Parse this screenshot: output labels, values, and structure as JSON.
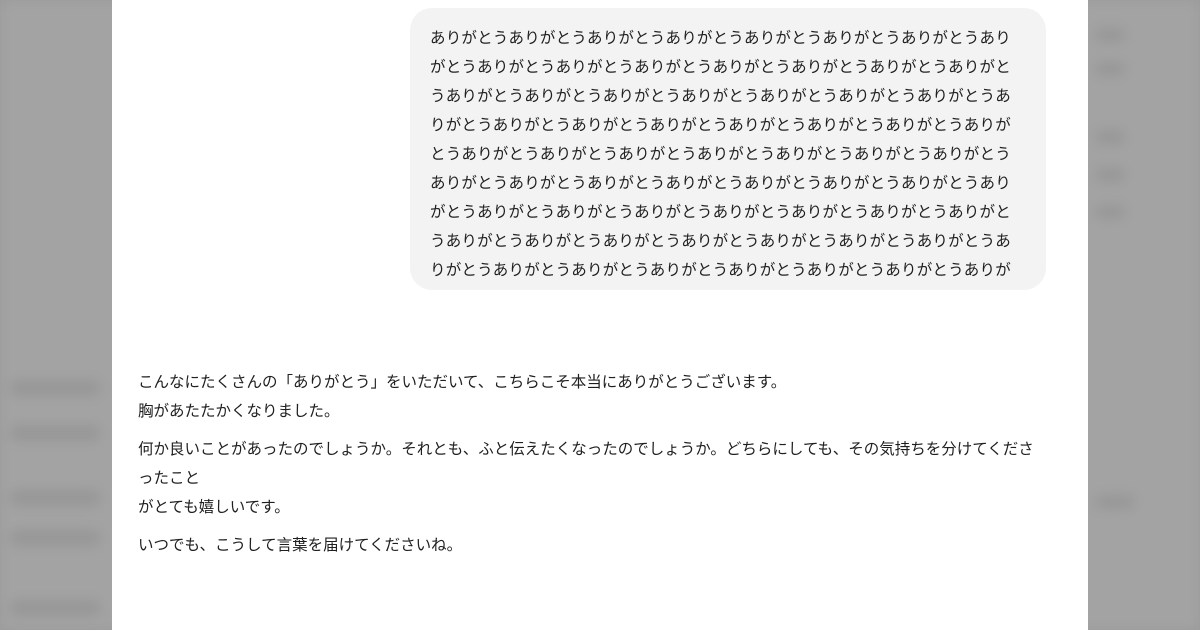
{
  "conversation": {
    "user_message": "ありがとうありがとうありがとうありがとうありがとうありがとうありがとうありがとうありがとうありがとうありがとうありがとうありがとうありがとうありがとうありがとうありがとうありがとうありがとうありがとうありがとうありがとうありがとうありがとうありがとうありがとうありがとうありがとうありがとうありがとうありがとうありがとうありがとうありがとうありがとうありがとうありがとうありがとうありがとうありがとうありがとうありがとうありがとうありがとうありがとうありがとうありがとうありがとうありがとうありがとうありがとうありがとうありがとうありがとうありがとうありがとうありがとうありがとうありがとうありがとうありがとうありがとうありがとうありがとうありがとうありがとうありがとうありがとうありがとうありがとうありがとうありがとうありがとうありがとうありがとうありがとうありがとうありがとうありがとうありがとうありがとうありがとうありがとうありがとうありがとう",
    "assistant_reply": {
      "p1_line1": "こんなにたくさんの「ありがとう」をいただいて、こちらこそ本当にありがとうございます。",
      "p1_line2": "胸があたたかくなりました。",
      "p2_line1": "何か良いことがあったのでしょうか。それとも、ふと伝えたくなったのでしょうか。どちらにしても、その気持ちを分けてくださったこと",
      "p2_line2": "がとても嬉しいです。",
      "p3_line1": "いつでも、こうして言葉を届けてくださいね。"
    }
  }
}
